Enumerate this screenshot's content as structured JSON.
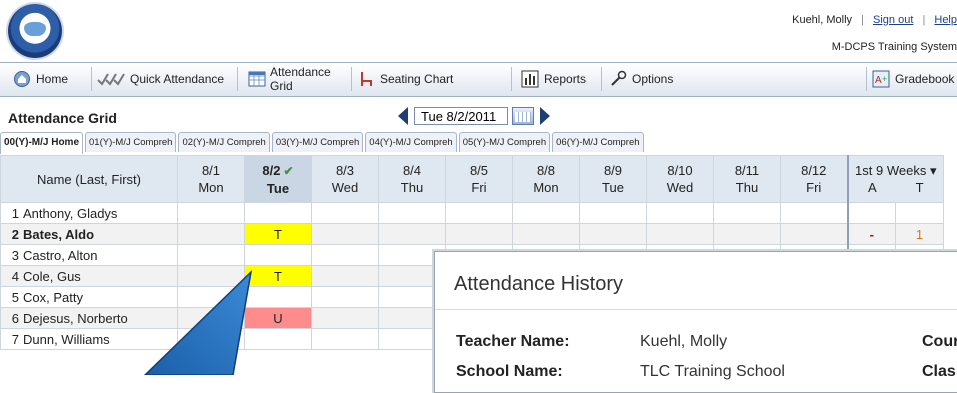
{
  "header": {
    "user_name": "Kuehl, Molly",
    "sign_out": "Sign out",
    "help": "Help",
    "system_name": "M-DCPS Training System"
  },
  "toolbar": {
    "items": [
      {
        "label": "Home",
        "icon": "home-icon"
      },
      {
        "label": "Quick Attendance",
        "icon": "check-marks-icon"
      },
      {
        "label": "Attendance Grid",
        "icon": "grid-icon"
      },
      {
        "label": "Seating Chart",
        "icon": "chair-icon"
      },
      {
        "label": "Reports",
        "icon": "bar-chart-icon"
      },
      {
        "label": "Options",
        "icon": "wrench-icon"
      },
      {
        "label": "Gradebook",
        "icon": "gradebook-icon"
      }
    ]
  },
  "page": {
    "title": "Attendance Grid",
    "date_value": "Tue 8/2/2011"
  },
  "tabs": [
    {
      "label": "00(Y)-M/J Home",
      "active": true
    },
    {
      "label": "01(Y)-M/J Compreh",
      "active": false
    },
    {
      "label": "02(Y)-M/J Compreh",
      "active": false
    },
    {
      "label": "03(Y)-M/J Compreh",
      "active": false
    },
    {
      "label": "04(Y)-M/J Compreh",
      "active": false
    },
    {
      "label": "05(Y)-M/J Compreh",
      "active": false
    },
    {
      "label": "06(Y)-M/J Compreh",
      "active": false
    }
  ],
  "grid": {
    "name_header": "Name (Last, First)",
    "days": [
      {
        "date": "8/1",
        "dow": "Mon"
      },
      {
        "date": "8/2",
        "dow": "Tue",
        "selected": true
      },
      {
        "date": "8/3",
        "dow": "Wed"
      },
      {
        "date": "8/4",
        "dow": "Thu"
      },
      {
        "date": "8/5",
        "dow": "Fri"
      },
      {
        "date": "8/8",
        "dow": "Mon"
      },
      {
        "date": "8/9",
        "dow": "Tue"
      },
      {
        "date": "8/10",
        "dow": "Wed"
      },
      {
        "date": "8/11",
        "dow": "Thu"
      },
      {
        "date": "8/12",
        "dow": "Fri"
      }
    ],
    "term": {
      "label": "1st 9 Weeks",
      "col_a": "A",
      "col_t": "T"
    },
    "students": [
      {
        "num": "1",
        "name": "Anthony, Gladys",
        "bold": false,
        "code": "",
        "a": "",
        "t": ""
      },
      {
        "num": "2",
        "name": "Bates, Aldo",
        "bold": true,
        "code": "T",
        "a": "-",
        "t": "1"
      },
      {
        "num": "3",
        "name": "Castro, Alton",
        "bold": false,
        "code": "",
        "a": "",
        "t": ""
      },
      {
        "num": "4",
        "name": "Cole, Gus",
        "bold": false,
        "code": "T",
        "a": "",
        "t": ""
      },
      {
        "num": "5",
        "name": "Cox, Patty",
        "bold": false,
        "code": "",
        "a": "",
        "t": ""
      },
      {
        "num": "6",
        "name": "Dejesus, Norberto",
        "bold": false,
        "code": "U",
        "a": "",
        "t": ""
      },
      {
        "num": "7",
        "name": "Dunn, Williams",
        "bold": false,
        "code": "",
        "a": "",
        "t": ""
      }
    ]
  },
  "popup": {
    "title": "Attendance History",
    "teacher_label": "Teacher Name:",
    "teacher_value": "Kuehl, Molly",
    "school_label": "School Name:",
    "school_value": "TLC Training School",
    "right_label_1": "Cour",
    "right_label_2": "Clas"
  },
  "colors": {
    "tardy": "#ffff00",
    "unexcused": "#ff8c8c",
    "callout": "#1f6fc0"
  }
}
